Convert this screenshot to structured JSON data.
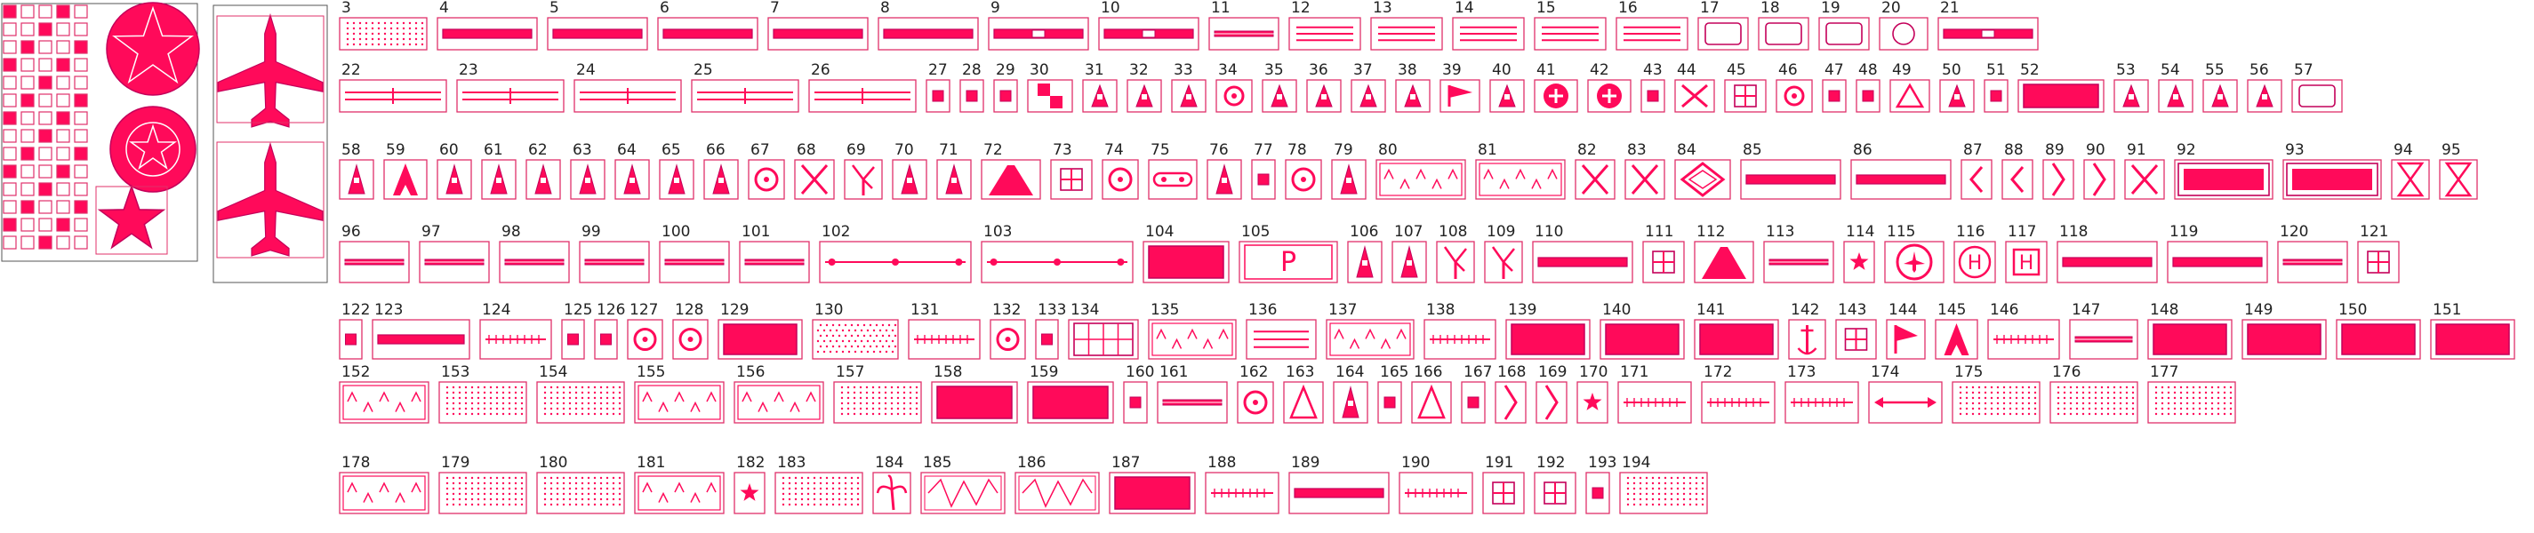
{
  "colors": {
    "accent": "#ff0a5a",
    "outline": "#c4005a",
    "frame": "#e0306a",
    "text": "#222222",
    "background": "#ffffff"
  },
  "symbols": [
    {
      "label": "3",
      "kind": "dots"
    },
    {
      "label": "4",
      "kind": "bar"
    },
    {
      "label": "5",
      "kind": "bar"
    },
    {
      "label": "6",
      "kind": "bar"
    },
    {
      "label": "7",
      "kind": "bar"
    },
    {
      "label": "8",
      "kind": "bar"
    },
    {
      "label": "9",
      "kind": "bar-mark"
    },
    {
      "label": "10",
      "kind": "bar-mark"
    },
    {
      "label": "11",
      "kind": "thin-bar"
    },
    {
      "label": "12",
      "kind": "lines"
    },
    {
      "label": "13",
      "kind": "lines"
    },
    {
      "label": "14",
      "kind": "lines"
    },
    {
      "label": "15",
      "kind": "lines"
    },
    {
      "label": "16",
      "kind": "lines"
    },
    {
      "label": "17",
      "kind": "box"
    },
    {
      "label": "18",
      "kind": "box"
    },
    {
      "label": "19",
      "kind": "box"
    },
    {
      "label": "20",
      "kind": "circle"
    },
    {
      "label": "21",
      "kind": "bar-mark"
    },
    {
      "label": "22",
      "kind": "double-line"
    },
    {
      "label": "23",
      "kind": "double-line"
    },
    {
      "label": "24",
      "kind": "double-line"
    },
    {
      "label": "25",
      "kind": "double-line"
    },
    {
      "label": "26",
      "kind": "double-line"
    },
    {
      "label": "27",
      "kind": "small-box"
    },
    {
      "label": "28",
      "kind": "small-box"
    },
    {
      "label": "29",
      "kind": "small-box"
    },
    {
      "label": "30",
      "kind": "quad"
    },
    {
      "label": "31",
      "kind": "tower"
    },
    {
      "label": "32",
      "kind": "tower"
    },
    {
      "label": "33",
      "kind": "tower"
    },
    {
      "label": "34",
      "kind": "ring"
    },
    {
      "label": "35",
      "kind": "tower"
    },
    {
      "label": "36",
      "kind": "tower"
    },
    {
      "label": "37",
      "kind": "tower"
    },
    {
      "label": "38",
      "kind": "tower"
    },
    {
      "label": "39",
      "kind": "flag"
    },
    {
      "label": "40",
      "kind": "tower"
    },
    {
      "label": "41",
      "kind": "cross-circle"
    },
    {
      "label": "42",
      "kind": "cross-circle"
    },
    {
      "label": "43",
      "kind": "small-box"
    },
    {
      "label": "44",
      "kind": "x-box"
    },
    {
      "label": "45",
      "kind": "cross-box"
    },
    {
      "label": "46",
      "kind": "ring"
    },
    {
      "label": "47",
      "kind": "small-box"
    },
    {
      "label": "48",
      "kind": "small-box"
    },
    {
      "label": "49",
      "kind": "triangle"
    },
    {
      "label": "50",
      "kind": "tower"
    },
    {
      "label": "51",
      "kind": "small-box"
    },
    {
      "label": "52",
      "kind": "fill"
    },
    {
      "label": "53",
      "kind": "tower"
    },
    {
      "label": "54",
      "kind": "tower"
    },
    {
      "label": "55",
      "kind": "tower"
    },
    {
      "label": "56",
      "kind": "tower"
    },
    {
      "label": "57",
      "kind": "box"
    },
    {
      "label": "58",
      "kind": "tower"
    },
    {
      "label": "59",
      "kind": "eiffel"
    },
    {
      "label": "60",
      "kind": "tower"
    },
    {
      "label": "61",
      "kind": "tower"
    },
    {
      "label": "62",
      "kind": "tower"
    },
    {
      "label": "63",
      "kind": "tower"
    },
    {
      "label": "64",
      "kind": "tower"
    },
    {
      "label": "65",
      "kind": "tower"
    },
    {
      "label": "66",
      "kind": "tower"
    },
    {
      "label": "67",
      "kind": "ring"
    },
    {
      "label": "68",
      "kind": "x-box"
    },
    {
      "label": "69",
      "kind": "windmill"
    },
    {
      "label": "70",
      "kind": "tower"
    },
    {
      "label": "71",
      "kind": "tower"
    },
    {
      "label": "72",
      "kind": "peak"
    },
    {
      "label": "73",
      "kind": "cross-box"
    },
    {
      "label": "74",
      "kind": "ring"
    },
    {
      "label": "75",
      "kind": "chain"
    },
    {
      "label": "76",
      "kind": "tower"
    },
    {
      "label": "77",
      "kind": "small-box"
    },
    {
      "label": "78",
      "kind": "ring"
    },
    {
      "label": "79",
      "kind": "tower"
    },
    {
      "label": "80",
      "kind": "grass"
    },
    {
      "label": "81",
      "kind": "grass"
    },
    {
      "label": "82",
      "kind": "x-box"
    },
    {
      "label": "83",
      "kind": "x-box"
    },
    {
      "label": "84",
      "kind": "diamond"
    },
    {
      "label": "85",
      "kind": "bar"
    },
    {
      "label": "86",
      "kind": "bar"
    },
    {
      "label": "87",
      "kind": "chevron"
    },
    {
      "label": "88",
      "kind": "chevron"
    },
    {
      "label": "89",
      "kind": "bracket"
    },
    {
      "label": "90",
      "kind": "bracket"
    },
    {
      "label": "91",
      "kind": "x-box"
    },
    {
      "label": "92",
      "kind": "frame"
    },
    {
      "label": "93",
      "kind": "frame"
    },
    {
      "label": "94",
      "kind": "hourglass"
    },
    {
      "label": "95",
      "kind": "hourglass"
    },
    {
      "label": "96",
      "kind": "thin-bar"
    },
    {
      "label": "97",
      "kind": "thin-bar"
    },
    {
      "label": "98",
      "kind": "thin-bar"
    },
    {
      "label": "99",
      "kind": "thin-bar"
    },
    {
      "label": "100",
      "kind": "thin-bar"
    },
    {
      "label": "101",
      "kind": "thin-bar"
    },
    {
      "label": "102",
      "kind": "dot-line"
    },
    {
      "label": "103",
      "kind": "dot-line"
    },
    {
      "label": "104",
      "kind": "fill"
    },
    {
      "label": "105",
      "kind": "parking"
    },
    {
      "label": "106",
      "kind": "tower"
    },
    {
      "label": "107",
      "kind": "tower"
    },
    {
      "label": "108",
      "kind": "windmill"
    },
    {
      "label": "109",
      "kind": "windmill"
    },
    {
      "label": "110",
      "kind": "bar"
    },
    {
      "label": "111",
      "kind": "cross-box"
    },
    {
      "label": "112",
      "kind": "peak"
    },
    {
      "label": "113",
      "kind": "thin-bar"
    },
    {
      "label": "114",
      "kind": "star"
    },
    {
      "label": "115",
      "kind": "plane-circle"
    },
    {
      "label": "116",
      "kind": "heli-circle"
    },
    {
      "label": "117",
      "kind": "heli"
    },
    {
      "label": "118",
      "kind": "bar"
    },
    {
      "label": "119",
      "kind": "bar"
    },
    {
      "label": "120",
      "kind": "thin-bar"
    },
    {
      "label": "121",
      "kind": "cross-box"
    },
    {
      "label": "122",
      "kind": "small-box"
    },
    {
      "label": "123",
      "kind": "bar"
    },
    {
      "label": "124",
      "kind": "rail"
    },
    {
      "label": "125",
      "kind": "small-box"
    },
    {
      "label": "126",
      "kind": "small-box"
    },
    {
      "label": "127",
      "kind": "ring"
    },
    {
      "label": "128",
      "kind": "ring"
    },
    {
      "label": "129",
      "kind": "fill"
    },
    {
      "label": "130",
      "kind": "dots"
    },
    {
      "label": "131",
      "kind": "rail"
    },
    {
      "label": "132",
      "kind": "ring"
    },
    {
      "label": "133",
      "kind": "small-box"
    },
    {
      "label": "134",
      "kind": "grid"
    },
    {
      "label": "135",
      "kind": "grass"
    },
    {
      "label": "136",
      "kind": "lines"
    },
    {
      "label": "137",
      "kind": "grass"
    },
    {
      "label": "138",
      "kind": "rail"
    },
    {
      "label": "139",
      "kind": "fill"
    },
    {
      "label": "140",
      "kind": "fill"
    },
    {
      "label": "141",
      "kind": "fill"
    },
    {
      "label": "142",
      "kind": "anchor"
    },
    {
      "label": "143",
      "kind": "cross-box"
    },
    {
      "label": "144",
      "kind": "flag"
    },
    {
      "label": "145",
      "kind": "eiffel"
    },
    {
      "label": "146",
      "kind": "rail"
    },
    {
      "label": "147",
      "kind": "thin-bar"
    },
    {
      "label": "148",
      "kind": "fill"
    },
    {
      "label": "149",
      "kind": "fill"
    },
    {
      "label": "150",
      "kind": "fill"
    },
    {
      "label": "151",
      "kind": "fill"
    },
    {
      "label": "152",
      "kind": "grass"
    },
    {
      "label": "153",
      "kind": "dots"
    },
    {
      "label": "154",
      "kind": "dots"
    },
    {
      "label": "155",
      "kind": "grass"
    },
    {
      "label": "156",
      "kind": "grass"
    },
    {
      "label": "157",
      "kind": "dots"
    },
    {
      "label": "158",
      "kind": "fill"
    },
    {
      "label": "159",
      "kind": "fill"
    },
    {
      "label": "160",
      "kind": "small-box"
    },
    {
      "label": "161",
      "kind": "thin-bar"
    },
    {
      "label": "162",
      "kind": "ring"
    },
    {
      "label": "163",
      "kind": "triangle"
    },
    {
      "label": "164",
      "kind": "tower"
    },
    {
      "label": "165",
      "kind": "small-box"
    },
    {
      "label": "166",
      "kind": "triangle"
    },
    {
      "label": "167",
      "kind": "small-box"
    },
    {
      "label": "168",
      "kind": "bracket"
    },
    {
      "label": "169",
      "kind": "bracket"
    },
    {
      "label": "170",
      "kind": "star"
    },
    {
      "label": "171",
      "kind": "rail"
    },
    {
      "label": "172",
      "kind": "rail"
    },
    {
      "label": "173",
      "kind": "rail"
    },
    {
      "label": "174",
      "kind": "arrow"
    },
    {
      "label": "175",
      "kind": "dots"
    },
    {
      "label": "176",
      "kind": "dots"
    },
    {
      "label": "177",
      "kind": "dots"
    },
    {
      "label": "178",
      "kind": "grass"
    },
    {
      "label": "179",
      "kind": "dots"
    },
    {
      "label": "180",
      "kind": "dots"
    },
    {
      "label": "181",
      "kind": "grass"
    },
    {
      "label": "182",
      "kind": "star"
    },
    {
      "label": "183",
      "kind": "dots"
    },
    {
      "label": "184",
      "kind": "palm"
    },
    {
      "label": "185",
      "kind": "scribble"
    },
    {
      "label": "186",
      "kind": "scribble"
    },
    {
      "label": "187",
      "kind": "fill"
    },
    {
      "label": "188",
      "kind": "rail"
    },
    {
      "label": "189",
      "kind": "bar"
    },
    {
      "label": "190",
      "kind": "rail"
    },
    {
      "label": "191",
      "kind": "cross-box"
    },
    {
      "label": "192",
      "kind": "cross-box"
    },
    {
      "label": "193",
      "kind": "small-box"
    },
    {
      "label": "194",
      "kind": "dots"
    }
  ]
}
